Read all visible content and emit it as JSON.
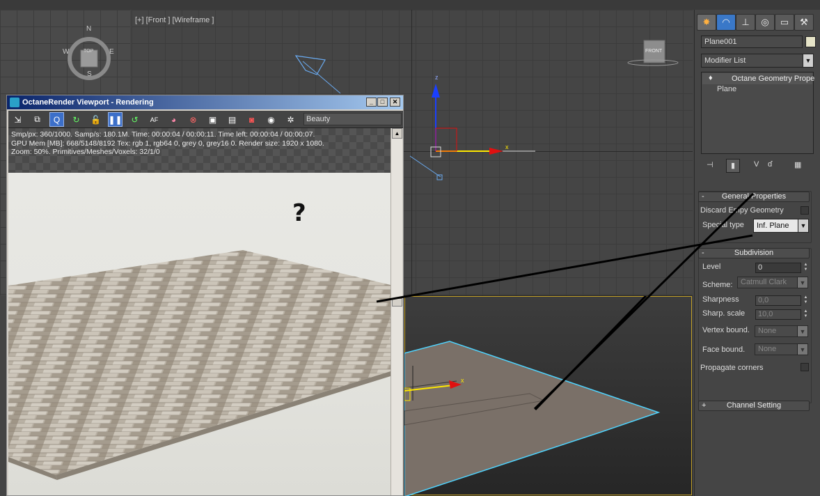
{
  "viewports": {
    "front_label": "[+] [Front ] [Wireframe ]",
    "viewcube_top_face": "TOP",
    "viewcube_front_face": "FRONT",
    "compass": {
      "n": "N",
      "s": "S",
      "e": "E",
      "w": "W"
    },
    "axis_x": "x",
    "axis_z": "z"
  },
  "octane_window": {
    "title": "OctaneRender Viewport - Rendering",
    "buttons": {
      "minimize": "_",
      "maximize": "□",
      "close": "✕"
    },
    "render_pass": "Beauty",
    "info_lines": [
      "Smp/px: 360/1000.   Samp/s: 180.1M.   Time: 00:00:04 / 00:00:11.   Time left: 00:00:04 / 00:00:07.",
      "GPU Mem [MB]: 668/5148/8192   Tex: rgb 1, rgb64 0, grey 0, grey16 0.   Render size: 1920 x 1080.",
      "Zoom: 50%.   Primitives/Meshes/Voxels: 32/1/0"
    ],
    "annotation": "?"
  },
  "command_panel": {
    "object_name": "Plane001",
    "modifier_list": "Modifier List",
    "stack": [
      "Octane Geometry Prope",
      "Plane"
    ],
    "general": {
      "title": "General Properties",
      "discard_empty": "Discard Empy Geometry",
      "special_type_label": "Special type",
      "special_type_value": "Inf. Plane"
    },
    "subdivision": {
      "title": "Subdivision",
      "level_label": "Level",
      "level_value": "0",
      "scheme_label": "Scheme:",
      "scheme_value": "Catmull Clark",
      "sharpness_label": "Sharpness",
      "sharpness_value": "0,0",
      "sharp_scale_label": "Sharp. scale",
      "sharp_scale_value": "10,0",
      "vertex_bound_label": "Vertex bound.",
      "vertex_bound_value": "None",
      "face_bound_label": "Face bound.",
      "face_bound_value": "None",
      "propagate_label": "Propagate corners"
    },
    "channel": {
      "title": "Channel Setting",
      "sign": "+"
    },
    "rollout_minus": "-"
  },
  "colors": {
    "selection_cyan": "#4fd4ff",
    "axis_x": "#ffe800",
    "axis_z": "#1a3fff",
    "octane_title": "#0a246a"
  }
}
